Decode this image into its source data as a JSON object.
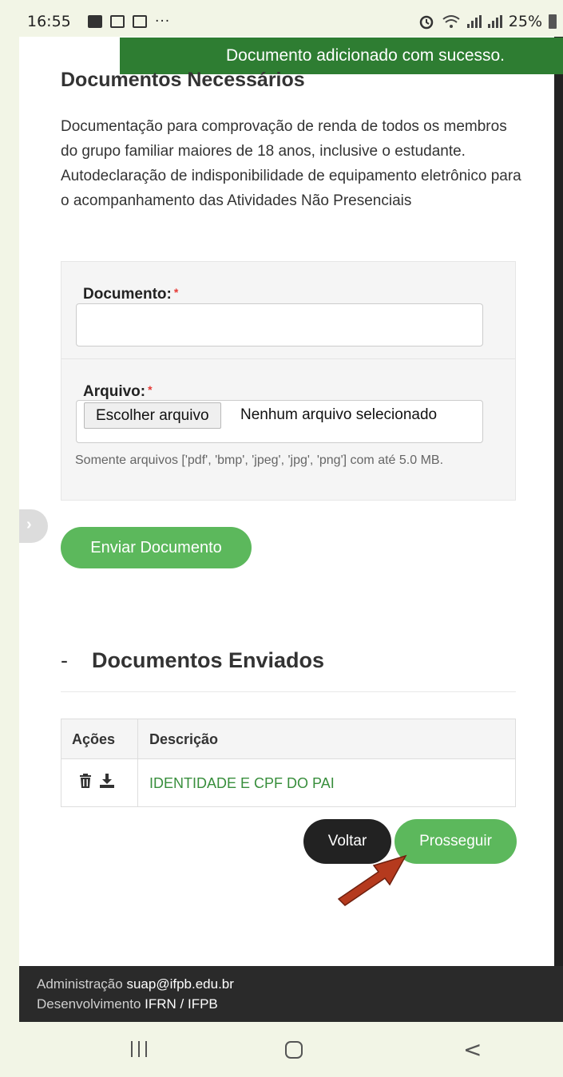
{
  "status_bar": {
    "time": "16:55",
    "overflow": "···",
    "battery": "25%"
  },
  "toast": {
    "message": "Documento adicionado com sucesso."
  },
  "required_docs": {
    "title": "Documentos Necessários",
    "line1": "Documentação para comprovação de renda de todos os membros do grupo familiar maiores de 18 anos, inclusive o estudante.",
    "line2": "Autodeclaração de indisponibilidade de equipamento eletrônico para o acompanhamento das Atividades Não Presenciais"
  },
  "form": {
    "document_label": "Documento:",
    "document_value": "",
    "file_label": "Arquivo:",
    "required_mark": "*",
    "file_button": "Escolher arquivo",
    "file_status": "Nenhum arquivo selecionado",
    "help_text": "Somente arquivos ['pdf', 'bmp', 'jpeg', 'jpg', 'png'] com até 5.0 MB.",
    "submit_label": "Enviar Documento"
  },
  "side_tab": {
    "glyph": "›"
  },
  "sent_docs": {
    "dash": "-",
    "title": "Documentos Enviados",
    "columns": [
      "Ações",
      "Descrição"
    ],
    "rows": [
      {
        "description": "IDENTIDADE E CPF DO PAI"
      }
    ]
  },
  "buttons": {
    "back": "Voltar",
    "proceed": "Prosseguir"
  },
  "footer": {
    "admin_label": "Administração",
    "admin_value": "suap@ifpb.edu.br",
    "dev_label": "Desenvolvimento",
    "dev_value": "IFRN / IFPB"
  },
  "icons": [
    "gallery-icon",
    "cast-icon",
    "mail-icon",
    "alarm-icon",
    "wifi-icon",
    "signal-icon",
    "battery-icon",
    "trash-icon",
    "download-icon",
    "arrow-annotation",
    "recents-icon",
    "home-icon",
    "back-icon"
  ],
  "colors": {
    "toast_bg": "#2e7d32",
    "primary_green": "#5cb85c",
    "link_green": "#388e3c",
    "required_red": "#e53935",
    "dark_button": "#222222",
    "footer_bg": "#2a2a2a",
    "arrow": "#b53a1e"
  }
}
